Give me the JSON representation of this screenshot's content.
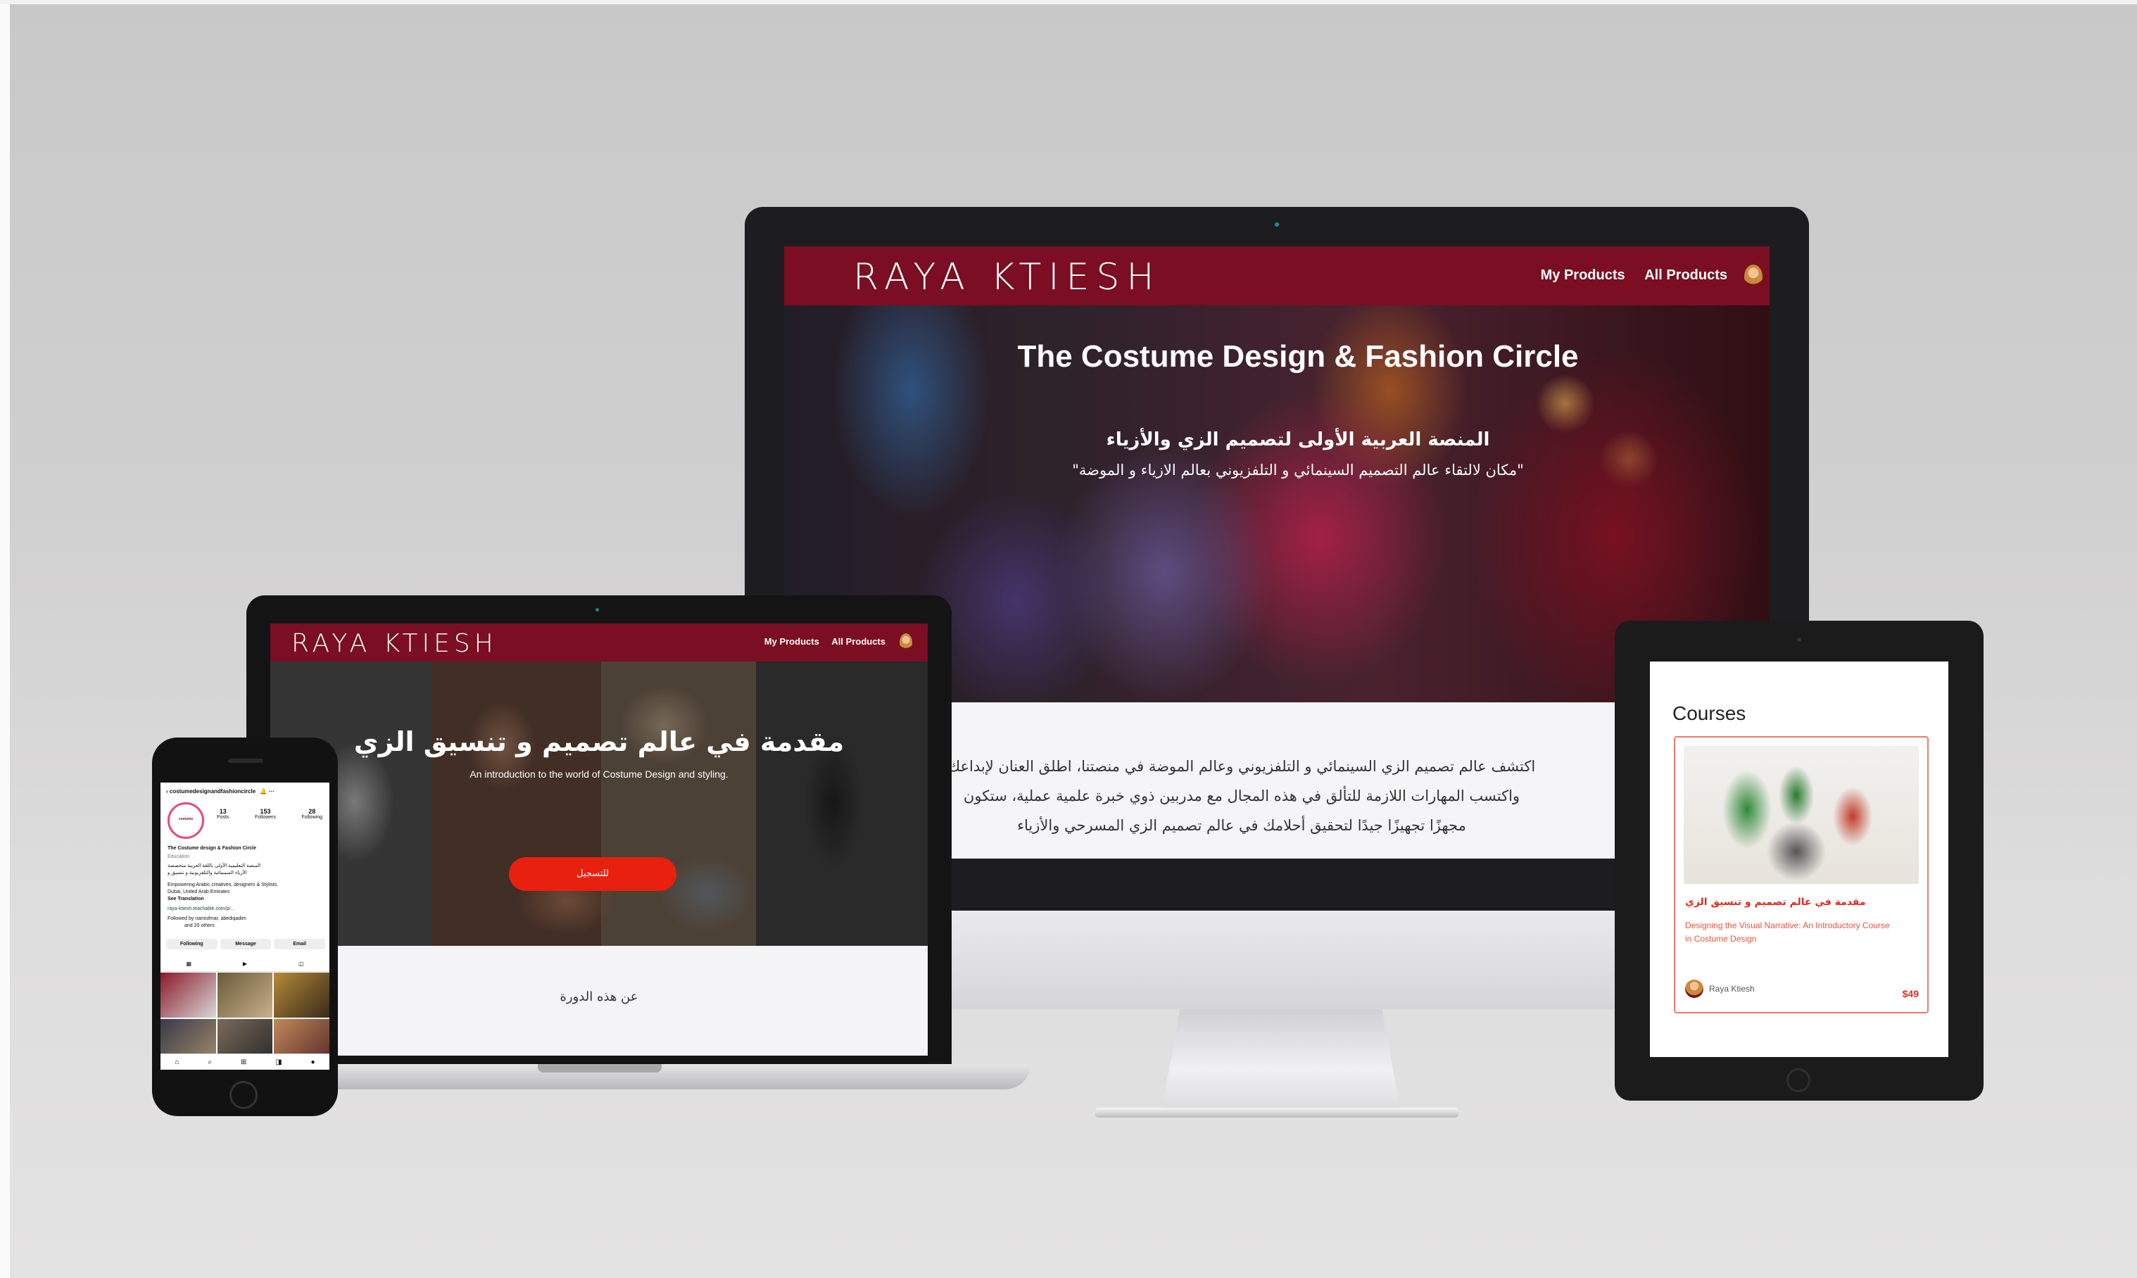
{
  "desktop": {
    "brand": "RAYA KTIESH",
    "nav": {
      "my_products": "My Products",
      "all_products": "All Products"
    },
    "hero_title": "The Costume Design & Fashion Circle",
    "hero_ar_title": "المنصة العربية الأولى لتصميم الزي والأزياء",
    "hero_ar_subtitle": "\"مكان لالتقاء عالم التصميم السينمائي و التلفزيوني بعالم الازياء و الموضة\"",
    "body_text": "اكتشف عالم تصميم الزي السينمائي و التلفزيوني وعالم الموضة في منصتنا، اطلق العنان لإبداعك واكتسب المهارات اللازمة للتألق في هذه المجال مع مدربين ذوي خبرة علمية عملية، ستكون مجهزًا تجهيزًا جيدًا لتحقيق أحلامك في عالم تصميم الزي المسرحي والأزياء"
  },
  "laptop": {
    "brand": "RAYA KTIESH",
    "nav": {
      "my_products": "My Products",
      "all_products": "All Products"
    },
    "hero_ar_title": "مقدمة في عالم تصميم و تنسيق الزي",
    "hero_en_subtitle": "An introduction to the world of Costume Design and styling.",
    "cta_label": "للتسجيل",
    "about_label": "عن هذه الدورة"
  },
  "phone": {
    "username": "costumedesignandfashioncircle",
    "logo_text": "costume",
    "stats": [
      {
        "value": "13",
        "label": "Posts"
      },
      {
        "value": "153",
        "label": "Followers"
      },
      {
        "value": "28",
        "label": "Following"
      }
    ],
    "profile_name": "The Costume design & Fashion Circle",
    "category": "Education",
    "bio_ar_1": "المنصة التعليمية الأولى باللغة العربية متخصصة",
    "bio_ar_2": "الأزياء السينمائية والتلفزيونية و تنسيق و",
    "bio_en": "Empowering Arabic creatives, designers & Stylists.",
    "location": "Dubai, United Arab Emirates",
    "see_translation": "See Translation",
    "link": "raya-ktiesh.teachable.com/p/...",
    "followed_by": "Followed by namisfmar, abediqadim",
    "followed_by_more": "and 20 others",
    "buttons": [
      "Following",
      "Message",
      "Email"
    ]
  },
  "tablet": {
    "section_title": "Courses",
    "course": {
      "title_ar": "مقدمة في عالم تصميم و تنسيق الزي",
      "subtitle": "Designing the Visual Narrative: An Introductory Course in Costume Design",
      "author": "Raya Ktiesh",
      "price": "$49"
    }
  }
}
